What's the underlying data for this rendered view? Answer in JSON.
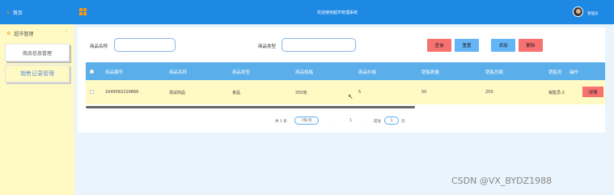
{
  "header": {
    "title": "欢迎使用超市管理系统",
    "username": "管理员"
  },
  "sidebar": {
    "home": "首页",
    "group": "超市管理",
    "items": [
      {
        "label": "商品信息管理"
      },
      {
        "label": "销售记录管理"
      }
    ]
  },
  "search": {
    "name_label": "商品名称",
    "type_label": "商品类型",
    "name_value": "",
    "type_value": ""
  },
  "buttons": {
    "query": "查询",
    "reset": "重置",
    "add": "添加",
    "delete": "删除",
    "detail": "详情"
  },
  "table": {
    "columns": [
      "商品编号",
      "商品名称",
      "商品类型",
      "商品规格",
      "商品价格",
      "销售数量",
      "销售总额",
      "销售员",
      "操作"
    ],
    "rows": [
      {
        "id": "1649582229866",
        "name": "测试商品",
        "type": "食品",
        "spec": "250克",
        "price": "5",
        "qty": "50",
        "total": "250",
        "seller": "销售员-2"
      }
    ]
  },
  "pagination": {
    "total": "共 1 条",
    "page_size": "7条/页",
    "prev": "‹",
    "current": "1",
    "next": "›",
    "goto_label": "前往",
    "goto_value": "1",
    "page_unit": "页"
  },
  "watermark": "CSDN @VX_BYDZ1988",
  "colors": {
    "header": "#1e88e5",
    "sidebar": "#fff9c4",
    "table_header": "#5aaeea",
    "danger": "#f87171",
    "primary": "#64b5f6"
  }
}
